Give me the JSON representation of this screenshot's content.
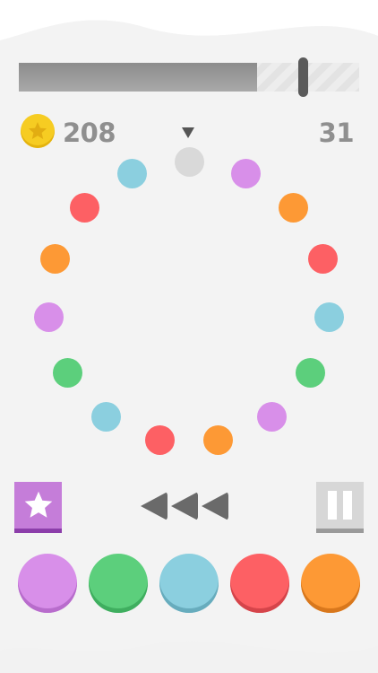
{
  "colors": {
    "purple": "#d88fe9",
    "green": "#5ccf7c",
    "blue": "#8bcfdf",
    "red": "#fd6064",
    "orange": "#fd9935",
    "gray": "#d9d9d9",
    "accent_star": "#c57dd9"
  },
  "hud": {
    "coins": "208",
    "score": "31",
    "progress_fraction": 0.7,
    "progress_marker_fraction": 0.835
  },
  "ring": [
    {
      "color": "gray",
      "icon": "ball"
    },
    {
      "color": "purple",
      "icon": "ball"
    },
    {
      "color": "orange",
      "icon": "ball"
    },
    {
      "color": "red",
      "icon": "ball"
    },
    {
      "color": "blue",
      "icon": "ball"
    },
    {
      "color": "green",
      "icon": "ball"
    },
    {
      "color": "purple",
      "icon": "ball"
    },
    {
      "color": "orange",
      "icon": "ball"
    },
    {
      "color": "red",
      "icon": "ball"
    },
    {
      "color": "blue",
      "icon": "ball"
    },
    {
      "color": "green",
      "icon": "ball"
    },
    {
      "color": "purple",
      "icon": "ball"
    },
    {
      "color": "orange",
      "icon": "ball"
    },
    {
      "color": "red",
      "icon": "ball"
    },
    {
      "color": "blue",
      "icon": "ball"
    }
  ],
  "controls": {
    "star_icon": "star-icon",
    "rewind_icon": "rewind-icon",
    "pause_icon": "pause-icon"
  },
  "palette": [
    {
      "color": "purple",
      "name": "purple-ball"
    },
    {
      "color": "green",
      "name": "green-ball"
    },
    {
      "color": "blue",
      "name": "blue-ball"
    },
    {
      "color": "red",
      "name": "red-ball"
    },
    {
      "color": "orange",
      "name": "orange-ball"
    }
  ]
}
